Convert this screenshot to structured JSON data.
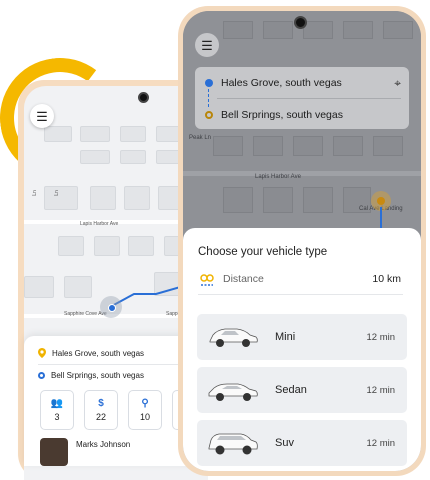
{
  "back_phone": {
    "map_labels": {
      "lapis_harbor": "Lapis Harbor Ave",
      "sapphire_cove_1": "Sapphire Cove Ave",
      "sapphire_cove_2": "Sapphi",
      "ln_1": "Ln",
      "ln_2": "Ln"
    },
    "pickup": "Hales Grove, south vegas",
    "dropoff": "Bell Srprings, south vegas",
    "stats": [
      {
        "icon": "group-icon",
        "value": "3"
      },
      {
        "icon": "dollar-icon",
        "value": "22"
      },
      {
        "icon": "route-icon",
        "value": "10"
      }
    ],
    "driver_name": "Marks Johnson"
  },
  "front_phone": {
    "map_labels": {
      "peak": "Peak Ln",
      "lapis_harbor": "Lapis Harbor Ave",
      "cal": "Cal Ave Landing"
    },
    "pickup": "Hales Grove, south vegas",
    "dropoff": "Bell Srprings, south vegas",
    "sheet_title": "Choose your vehicle type",
    "distance_label": "Distance",
    "distance_value": "10 km",
    "vehicles": [
      {
        "name": "Mini",
        "time": "12 min"
      },
      {
        "name": "Sedan",
        "time": "12 min"
      },
      {
        "name": "Suv",
        "time": "12 min"
      }
    ]
  },
  "colors": {
    "accent": "#f5b800",
    "route": "#2a6fd6"
  }
}
